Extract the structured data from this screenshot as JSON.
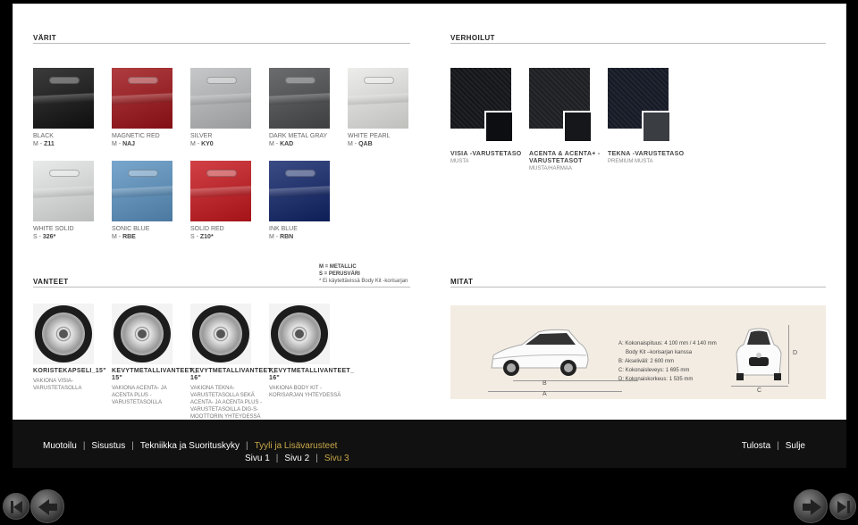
{
  "sections": {
    "colors": "VÄRIT",
    "upholstery": "VERHOILUT",
    "wheels": "VANTEET",
    "dimensions": "MITAT"
  },
  "colors": [
    {
      "name": "BLACK",
      "code_prefix": "M - ",
      "code": "Z11",
      "hex": "#111111"
    },
    {
      "name": "MAGNETIC RED",
      "code_prefix": "M - ",
      "code": "NAJ",
      "hex": "#9e1216"
    },
    {
      "name": "SILVER",
      "code_prefix": "M - ",
      "code": "KY0",
      "hex": "#b9bcbd"
    },
    {
      "name": "DARK METAL GRAY",
      "code_prefix": "M - ",
      "code": "KAD",
      "hex": "#4a4c4e"
    },
    {
      "name": "WHITE PEARL",
      "code_prefix": "M - ",
      "code": "QAB",
      "hex": "#e9e9e6"
    },
    {
      "name": "WHITE SOLID",
      "code_prefix": "S - ",
      "code": "326*",
      "hex": "#e4e6e6"
    },
    {
      "name": "SONIC BLUE",
      "code_prefix": "M - ",
      "code": "RBE",
      "hex": "#5b93c2"
    },
    {
      "name": "SOLID RED",
      "code_prefix": "S - ",
      "code": "Z10*",
      "hex": "#c7171d"
    },
    {
      "name": "INK BLUE",
      "code_prefix": "M - ",
      "code": "RBN",
      "hex": "#10246a"
    }
  ],
  "color_legend": {
    "line1": "M = METALLIC",
    "line2": "S = PERUSVÄRI",
    "line3": "* Ei käytettävissä Body Kit -korisarjan"
  },
  "upholstery": [
    {
      "name": "VISIA -VARUSTETASO",
      "sub": "MUSTA",
      "hex_big": "#14161a",
      "hex_small": "#0c0e11"
    },
    {
      "name": "ACENTA & ACENTA+ -VARUSTETASOT",
      "sub": "MUSTA/HARMAA",
      "hex_big": "#1e1f22",
      "hex_small": "#15171a"
    },
    {
      "name": "TEKNA -VARUSTETASO",
      "sub": "PREMIUM MUSTA",
      "hex_big": "#151a26",
      "hex_small": "#3a3d42"
    }
  ],
  "wheels": [
    {
      "name": "KORISTEKAPSELI_15\"",
      "desc": "VAKIONA VISIA-VARUSTETASOLLA"
    },
    {
      "name": "KEVYTMETALLIVANTEET_ 15\"",
      "desc": "VAKIONA ACENTA- JA ACENTA PLUS -VARUSTETASOILLA"
    },
    {
      "name": "KEVYTMETALLIVANTEET_ 16\"",
      "desc": "VAKIONA TEKNA-VARUSTETASOLLA SEKÄ ACENTA- JA ACENTA PLUS -VARUSTETASOILLA DIG-S-MOOTTORIN YHTEYDESSÄ"
    },
    {
      "name": "KEVYTMETALLIVANTEET_ 16\"",
      "desc": "VAKIONA BODY KIT -KORISARJAN YHTEYDESSÄ"
    }
  ],
  "dimensions": {
    "specs": [
      "A: Kokonaispituus: 4 100 mm / 4 140 mm",
      "Body Kit –korisarjan kanssa",
      "B: Akseliväli: 2 600 mm",
      "C: Kokonaisleveys: 1 695 mm",
      "D: Kokonaiskorkeus: 1 535 mm"
    ],
    "labels": {
      "a": "A",
      "b": "B",
      "c": "C",
      "d": "D"
    }
  },
  "nav": {
    "main": [
      "Muotoilu",
      "Sisustus",
      "Tekniikka ja Suorituskyky",
      "Tyyli ja Lisävarusteet"
    ],
    "active_index": 3,
    "pages": [
      "Sivu 1",
      "Sivu 2",
      "Sivu 3"
    ],
    "active_page": 2,
    "right": [
      "Tulosta",
      "Sulje"
    ]
  }
}
